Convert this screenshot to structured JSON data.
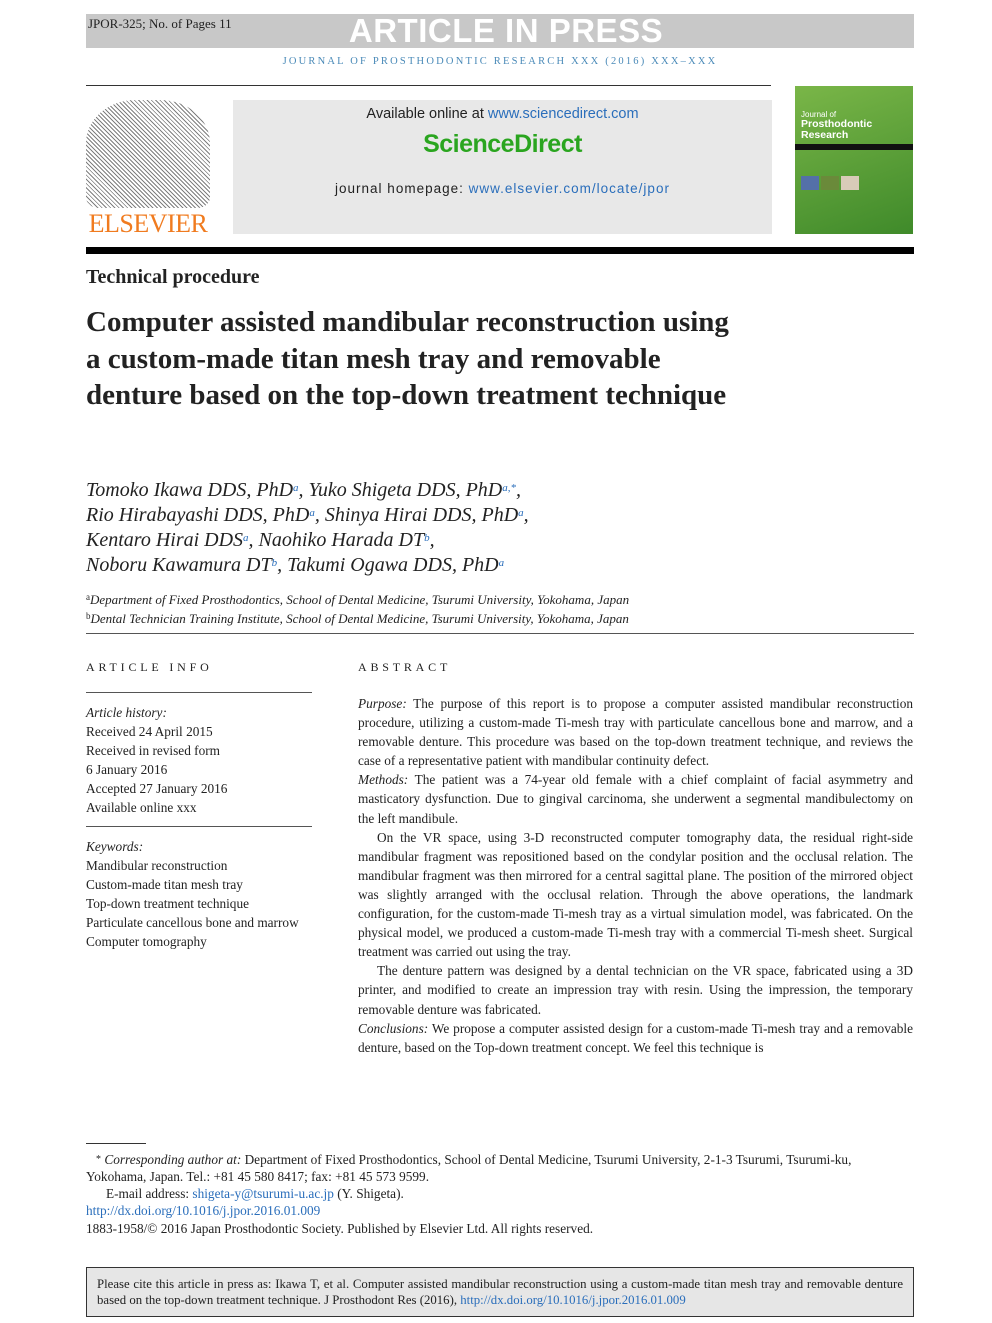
{
  "header": {
    "doc_id": "JPOR-325; No. of Pages 11",
    "banner": "ARTICLE IN PRESS",
    "journal_line": "JOURNAL OF PROSTHODONTIC RESEARCH XXX (2016) XXX–XXX"
  },
  "publisher": {
    "logo_text": "ELSEVIER",
    "available_prefix": "Available online at ",
    "available_link": "www.sciencedirect.com",
    "brand": "ScienceDirect",
    "homepage_prefix": "journal homepage: ",
    "homepage_link": "www.elsevier.com/locate/jpor",
    "cover_title_1": "Journal of",
    "cover_title_2": "Prosthodontic",
    "cover_title_3": "Research"
  },
  "colors": {
    "link": "#2a6ebb",
    "sciencedirect": "#2aa51f",
    "elsevier": "#f07b1f",
    "cover": "#5fa33a"
  },
  "article": {
    "section": "Technical procedure",
    "title": "Computer assisted mandibular reconstruction using a custom-made titan mesh tray and removable denture based on the top-down treatment technique",
    "authors": [
      {
        "name": "Tomoko Ikawa DDS, PhD",
        "sup": "a",
        "sep": ", "
      },
      {
        "name": "Yuko Shigeta DDS, PhD",
        "sup": "a,*",
        "sep": ",\n"
      },
      {
        "name": "Rio Hirabayashi DDS, PhD",
        "sup": "a",
        "sep": ", "
      },
      {
        "name": "Shinya Hirai DDS, PhD",
        "sup": "a",
        "sep": ",\n"
      },
      {
        "name": "Kentaro Hirai DDS",
        "sup": "a",
        "sep": ", "
      },
      {
        "name": "Naohiko Harada DT",
        "sup": "b",
        "sep": ",\n"
      },
      {
        "name": "Noboru Kawamura DT",
        "sup": "b",
        "sep": ", "
      },
      {
        "name": "Takumi Ogawa DDS, PhD",
        "sup": "a",
        "sep": ""
      }
    ],
    "affiliations": [
      {
        "key": "a",
        "text": "Department of Fixed Prosthodontics, School of Dental Medicine, Tsurumi University, Yokohama, Japan"
      },
      {
        "key": "b",
        "text": "Dental Technician Training Institute, School of Dental Medicine, Tsurumi University, Yokohama, Japan"
      }
    ]
  },
  "article_info": {
    "heading": "ARTICLE INFO",
    "history_label": "Article history:",
    "history": [
      "Received 24 April 2015",
      "Received in revised form",
      "6 January 2016",
      "Accepted 27 January 2016",
      "Available online xxx"
    ],
    "keywords_label": "Keywords:",
    "keywords": [
      "Mandibular reconstruction",
      "Custom-made titan mesh tray",
      "Top-down treatment technique",
      "Particulate cancellous bone and marrow",
      "Computer tomography"
    ]
  },
  "abstract": {
    "heading": "ABSTRACT",
    "paragraphs": [
      {
        "label": "Purpose:",
        "text": " The purpose of this report is to propose a computer assisted mandibular reconstruction procedure, utilizing a custom-made Ti-mesh tray with particulate cancellous bone and marrow, and a removable denture. This procedure was based on the top-down treatment technique, and reviews the case of a representative patient with mandibular continuity defect."
      },
      {
        "label": "Methods:",
        "text": " The patient was a 74-year old female with a chief complaint of facial asymmetry and masticatory dysfunction. Due to gingival carcinoma, she underwent a segmental mandibulectomy on the left mandibule."
      },
      {
        "label": "",
        "text": "On the VR space, using 3-D reconstructed computer tomography data, the residual right-side mandibular fragment was repositioned based on the condylar position and the occlusal relation. The mandibular fragment was then mirrored for a central sagittal plane. The position of the mirrored object was slightly arranged with the occlusal relation. Through the above operations, the landmark configuration, for the custom-made Ti-mesh tray as a virtual simulation model, was fabricated. On the physical model, we produced a custom-made Ti-mesh tray with a commercial Ti-mesh sheet. Surgical treatment was carried out using the tray."
      },
      {
        "label": "",
        "text": "The denture pattern was designed by a dental technician on the VR space, fabricated using a 3D printer, and modified to create an impression tray with resin. Using the impression, the temporary removable denture was fabricated."
      },
      {
        "label": "Conclusions:",
        "text": " We propose a computer assisted design for a custom-made Ti-mesh tray and a removable denture, based on the Top-down treatment concept. We feel this technique is"
      }
    ]
  },
  "footnote": {
    "star": "*",
    "corr_label": "Corresponding author at:",
    "corr_text": " Department of Fixed Prosthodontics, School of Dental Medicine, Tsurumi University, 2-1-3 Tsurumi, Tsurumi-ku, Yokohama, Japan. Tel.: +81 45 580 8417; fax: +81 45 573 9599.",
    "email_label": "E-mail address: ",
    "email": "shigeta-y@tsurumi-u.ac.jp",
    "email_suffix": " (Y. Shigeta).",
    "doi": "http://dx.doi.org/10.1016/j.jpor.2016.01.009",
    "copyright": "1883-1958/© 2016 Japan Prosthodontic Society. Published by Elsevier Ltd. All rights reserved."
  },
  "citation": {
    "text": "Please cite this article in press as: Ikawa T, et al. Computer assisted mandibular reconstruction using a custom-made titan mesh tray and removable denture based on the top-down treatment technique. J Prosthodont Res (2016), ",
    "link": "http://dx.doi.org/10.1016/j.jpor.2016.01.009"
  }
}
